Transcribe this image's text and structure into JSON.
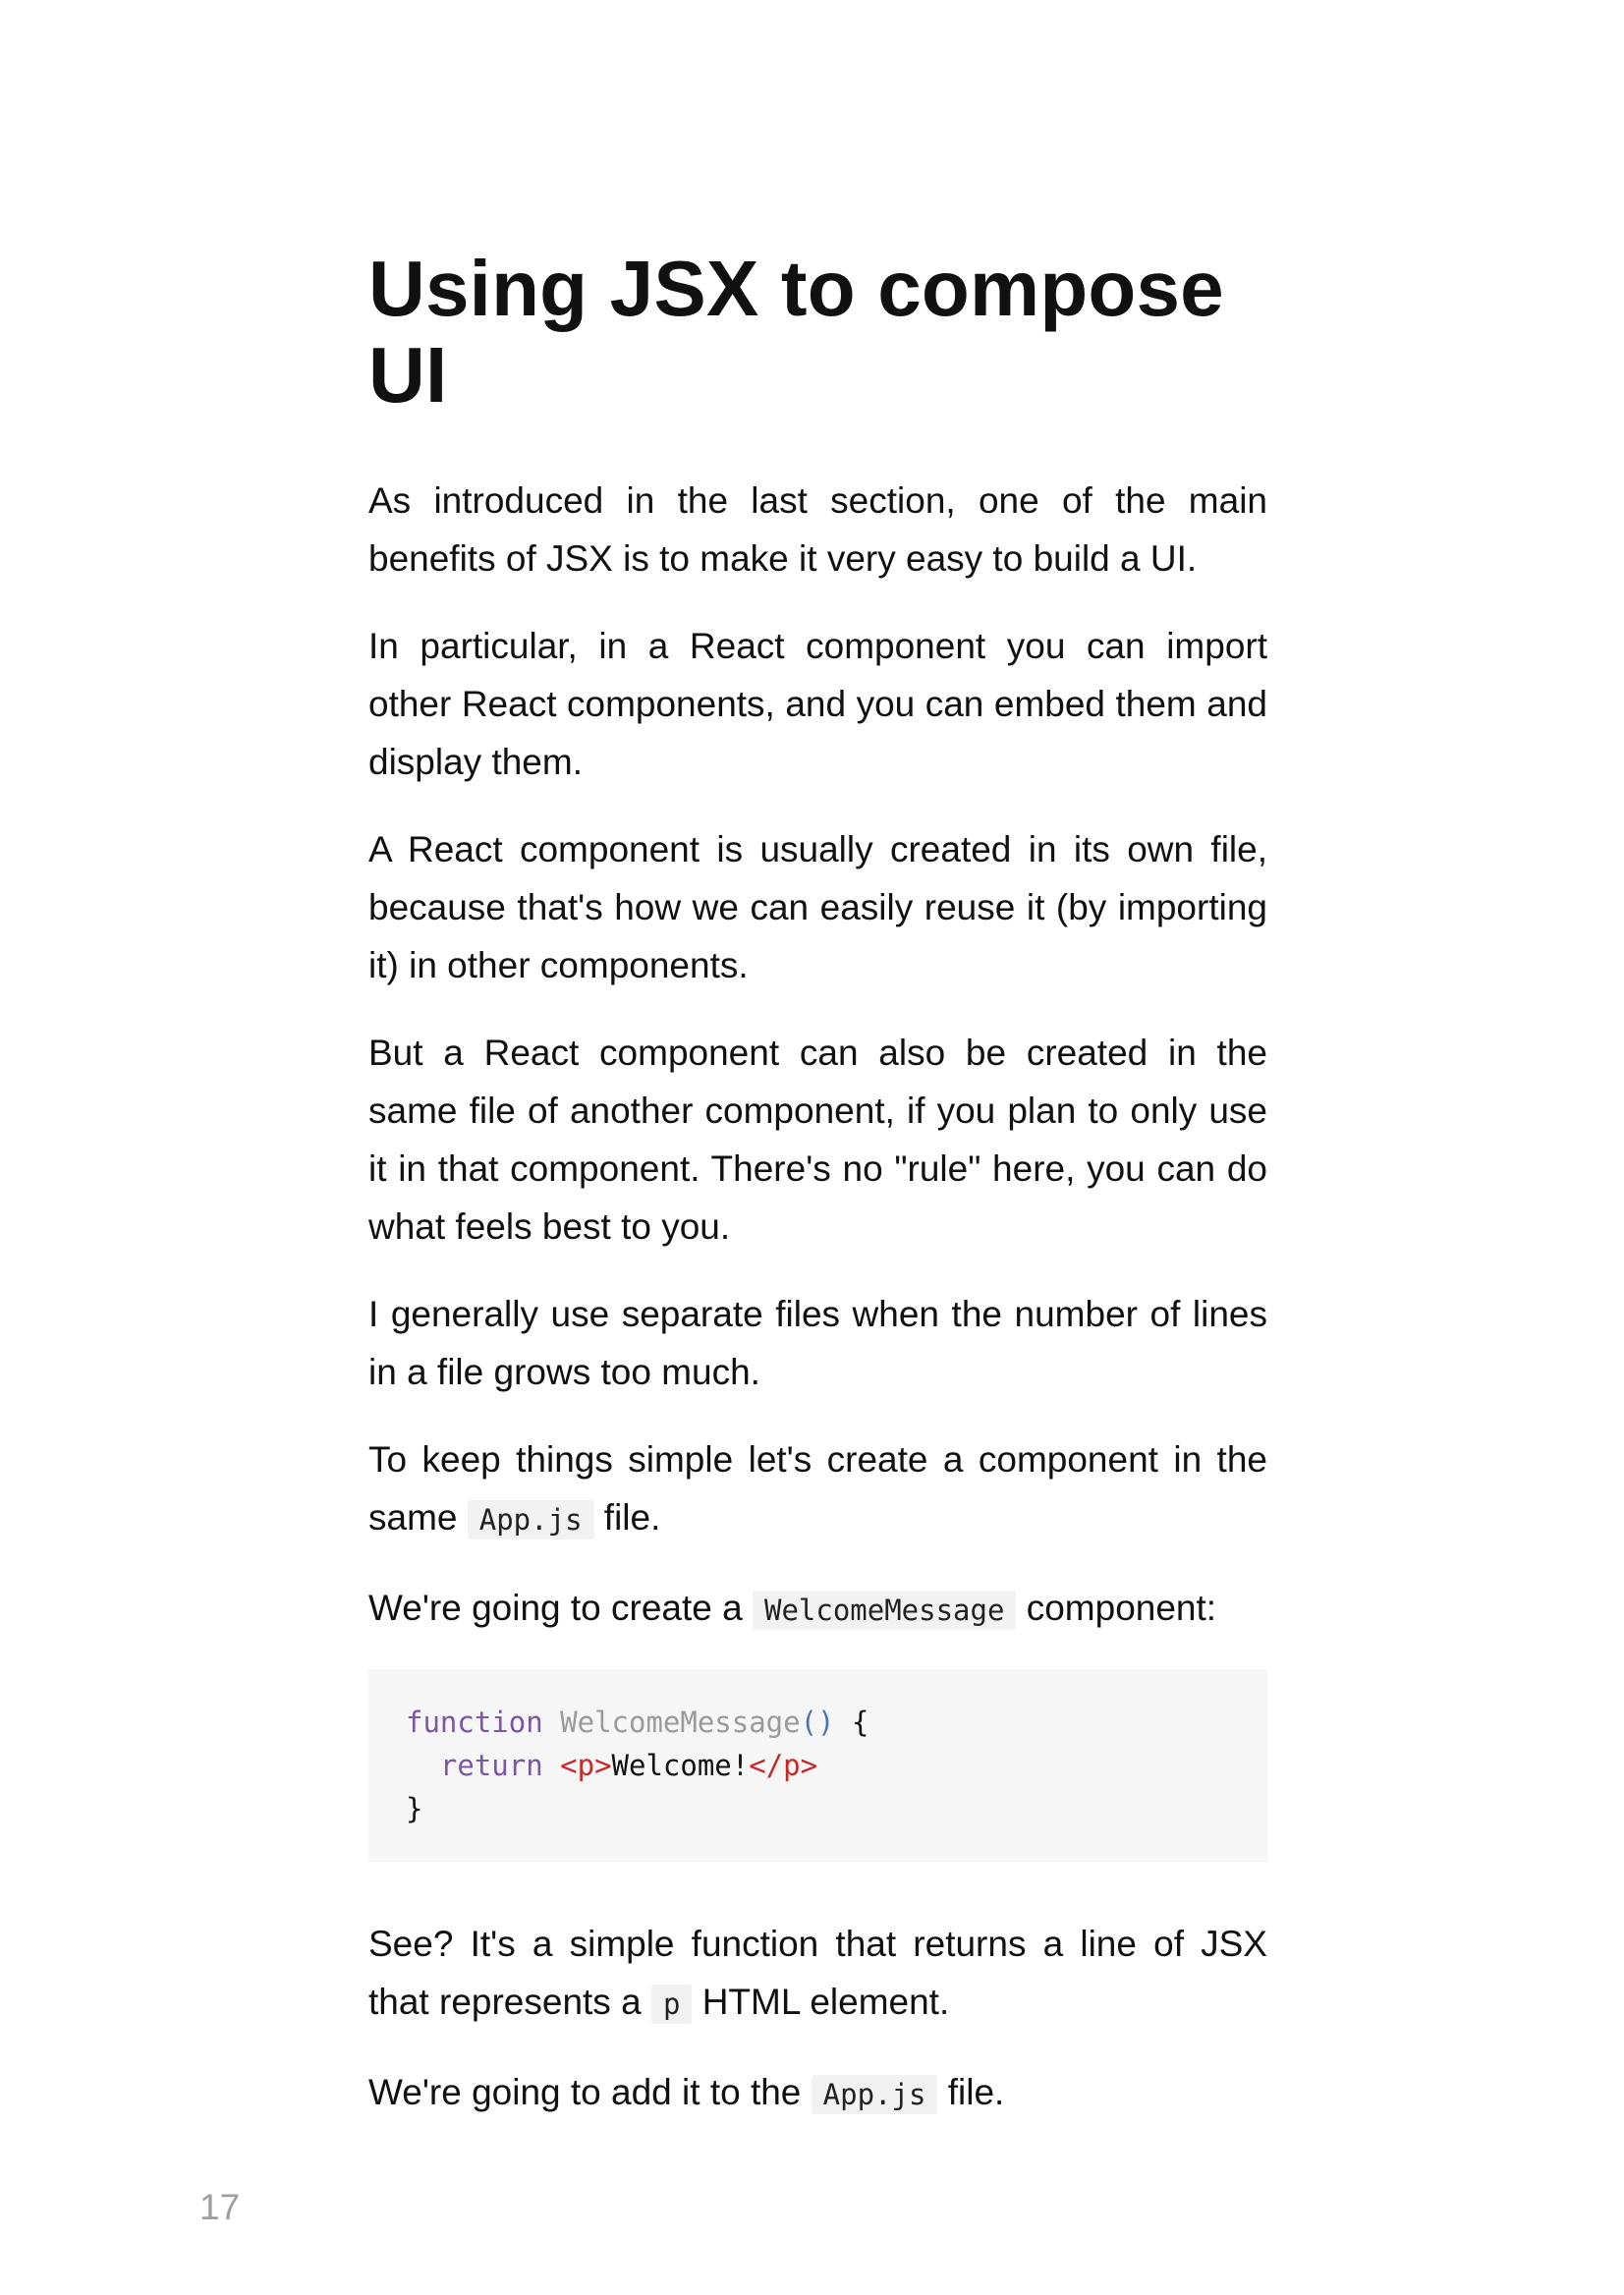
{
  "title": "Using JSX to compose UI",
  "paragraphs": {
    "p1": "As introduced in the last section, one of the main benefits of JSX is to make it very easy to build a UI.",
    "p2": "In particular, in a React component you can import other React components, and you can embed them and display them.",
    "p3": "A React component is usually created in its own file, because that's how we can easily reuse it (by importing it) in other components.",
    "p4": "But a React component can also be created in the same file of another component, if you plan to only use it in that component. There's no \"rule\" here, you can do what feels best to you.",
    "p5": "I generally use separate files when the number of lines in a file grows too much.",
    "p6": {
      "before": "To keep things simple let's create a component in the same ",
      "code": "App.js",
      "after": " file."
    },
    "p7": {
      "before": "We're going to create a ",
      "code": "WelcomeMessage",
      "after": " component:"
    },
    "p8": {
      "before": "See? It's a simple function that returns a line of JSX that represents a ",
      "code": "p",
      "after": " HTML element."
    },
    "p9": {
      "before": "We're going to add it to the ",
      "code": "App.js",
      "after": " file."
    }
  },
  "code_block": {
    "line1": {
      "keyword": "function",
      "name": "WelcomeMessage",
      "parens": "()",
      "brace": " {"
    },
    "line2": {
      "indent": "  ",
      "keyword": "return",
      "open_tag": "<p>",
      "text": "Welcome!",
      "close_tag": "</p>"
    },
    "line3": {
      "brace": "}"
    }
  },
  "page_number": "17"
}
